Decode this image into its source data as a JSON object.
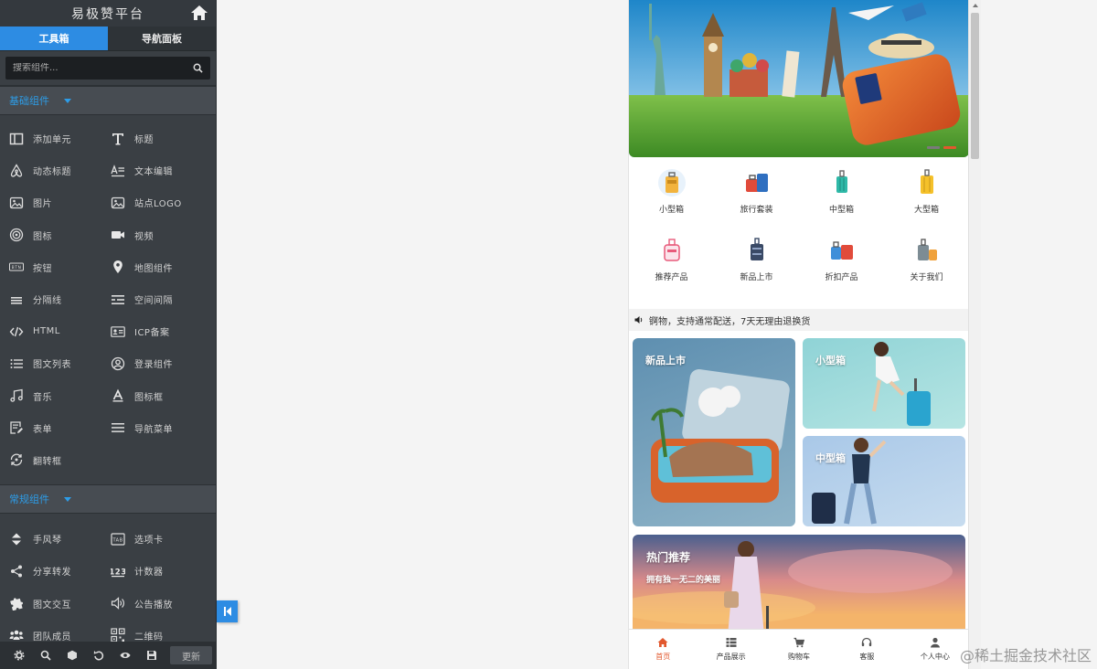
{
  "app": {
    "title": "易极赞平台"
  },
  "tabs": [
    {
      "label": "工具箱",
      "active": true
    },
    {
      "label": "导航面板",
      "active": false
    }
  ],
  "search": {
    "placeholder": "搜索组件..."
  },
  "sections": [
    {
      "title": "基础组件",
      "items": [
        {
          "label": "添加单元",
          "icon": "layout-icon"
        },
        {
          "label": "标题",
          "icon": "title-t-icon"
        },
        {
          "label": "动态标题",
          "icon": "airbnb-icon"
        },
        {
          "label": "文本编辑",
          "icon": "text-edit-icon"
        },
        {
          "label": "图片",
          "icon": "image-icon"
        },
        {
          "label": "站点LOGO",
          "icon": "logo-image-icon"
        },
        {
          "label": "图标",
          "icon": "target-icon"
        },
        {
          "label": "视频",
          "icon": "video-icon"
        },
        {
          "label": "按钮",
          "icon": "btn-icon"
        },
        {
          "label": "地图组件",
          "icon": "map-pin-icon"
        },
        {
          "label": "分隔线",
          "icon": "divider-icon"
        },
        {
          "label": "空间间隔",
          "icon": "spacing-icon"
        },
        {
          "label": "HTML",
          "icon": "code-icon"
        },
        {
          "label": "ICP备案",
          "icon": "id-card-icon"
        },
        {
          "label": "图文列表",
          "icon": "list-icon"
        },
        {
          "label": "登录组件",
          "icon": "user-circle-icon"
        },
        {
          "label": "音乐",
          "icon": "music-icon"
        },
        {
          "label": "图标框",
          "icon": "font-icon"
        },
        {
          "label": "表单",
          "icon": "form-icon"
        },
        {
          "label": "导航菜单",
          "icon": "menu-icon"
        },
        {
          "label": "翻转框",
          "icon": "flip-icon"
        }
      ]
    },
    {
      "title": "常规组件",
      "items": [
        {
          "label": "手风琴",
          "icon": "accordion-icon"
        },
        {
          "label": "选项卡",
          "icon": "tab-icon"
        },
        {
          "label": "分享转发",
          "icon": "share-icon"
        },
        {
          "label": "计数器",
          "icon": "counter-icon"
        },
        {
          "label": "图文交互",
          "icon": "puzzle-icon"
        },
        {
          "label": "公告播放",
          "icon": "speaker-icon"
        },
        {
          "label": "团队成员",
          "icon": "team-icon"
        },
        {
          "label": "二维码",
          "icon": "qrcode-icon"
        }
      ]
    }
  ],
  "bottom_toolbar": {
    "icons": [
      "settings-icon",
      "search-icon",
      "cube-icon",
      "undo-icon",
      "eye-icon",
      "save-icon"
    ],
    "update_label": "更新"
  },
  "preview": {
    "categories": [
      {
        "label": "小型箱",
        "color": "#f2b33d"
      },
      {
        "label": "旅行套装",
        "color": "#e14b3b"
      },
      {
        "label": "中型箱",
        "color": "#2fb9a8"
      },
      {
        "label": "大型箱",
        "color": "#f5c12a"
      },
      {
        "label": "推荐产品",
        "color": "#e85a7a"
      },
      {
        "label": "新品上市",
        "color": "#3a4a66"
      },
      {
        "label": "折扣产品",
        "color": "#3f8fd9"
      },
      {
        "label": "关于我们",
        "color": "#7d8c94"
      }
    ],
    "notice": "锕物，支持通常配送，7天无理由退换货",
    "cards": {
      "new": "新品上市",
      "small": "小型箱",
      "medium": "中型箱"
    },
    "hot": {
      "title": "热门推荐",
      "subtitle": "拥有独一无二的美丽"
    },
    "tabbar": [
      {
        "label": "首页",
        "active": true
      },
      {
        "label": "产品展示",
        "active": false
      },
      {
        "label": "购物车",
        "active": false
      },
      {
        "label": "客服",
        "active": false
      },
      {
        "label": "个人中心",
        "active": false
      }
    ]
  },
  "watermark": "@稀土掘金技术社区",
  "colors": {
    "accent": "#2d8ce3",
    "section_title": "#2d9de8",
    "brand_orange": "#e2582e"
  }
}
